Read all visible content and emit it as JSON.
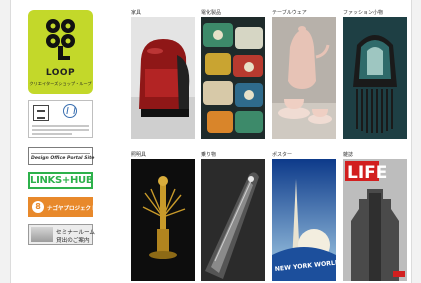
{
  "sidebar": {
    "logo": {
      "brand": "LOOP",
      "tagline": "クリエイターズショップ・ループ"
    },
    "unesco_banner": {
      "alt": "UNESCO / Creative Cities Network"
    },
    "design_office": {
      "label": "Design Office Portal Site"
    },
    "links_hub": {
      "label": "LINKS+HUB"
    },
    "nagoya_project": {
      "badge": "8",
      "label": "ナゴヤプロジェクト8"
    },
    "seminar_room": {
      "line1": "セミナールーム",
      "line2": "貸出のご案内"
    }
  },
  "gallery": {
    "row1": [
      {
        "label": "家具"
      },
      {
        "label": "電化製品"
      },
      {
        "label": "テーブルウェア"
      },
      {
        "label": "ファッション小物"
      }
    ],
    "row2": [
      {
        "label": "照明具"
      },
      {
        "label": "乗り物"
      },
      {
        "label": "ポスター"
      },
      {
        "label": "雑誌"
      }
    ]
  },
  "poster": {
    "text": "NEW YORK WORLD'S"
  },
  "magazine": {
    "masthead": "LIFE"
  },
  "colors": {
    "logo_bg": "#c3d82a",
    "links_green": "#2db14b",
    "nagoya_orange": "#e8892b"
  }
}
